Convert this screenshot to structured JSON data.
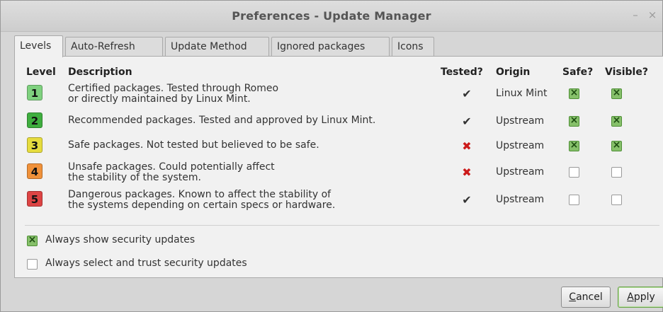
{
  "window": {
    "title": "Preferences - Update Manager",
    "minimize_glyph": "–",
    "close_glyph": "×"
  },
  "tabs": [
    {
      "label": "Levels",
      "active": true
    },
    {
      "label": "Auto-Refresh",
      "active": false
    },
    {
      "label": "Update Method",
      "active": false
    },
    {
      "label": "Ignored packages",
      "active": false
    },
    {
      "label": "Icons",
      "active": false
    }
  ],
  "table": {
    "headers": {
      "level": "Level",
      "description": "Description",
      "tested": "Tested?",
      "origin": "Origin",
      "safe": "Safe?",
      "visible": "Visible?"
    },
    "rows": [
      {
        "level": "1",
        "color": "#7fd17f",
        "line1": "Certified packages. Tested through Romeo",
        "line2": "or directly maintained by Linux Mint.",
        "tested": "✔",
        "tested_state": "yes",
        "origin": "Linux Mint",
        "safe": true,
        "visible": true
      },
      {
        "level": "2",
        "color": "#3fae3f",
        "line1": "Recommended packages. Tested and approved by Linux Mint.",
        "line2": "",
        "tested": "✔",
        "tested_state": "yes",
        "origin": "Upstream",
        "safe": true,
        "visible": true
      },
      {
        "level": "3",
        "color": "#e6dc3e",
        "line1": "Safe packages. Not tested but believed to be safe.",
        "line2": "",
        "tested": "✖",
        "tested_state": "no",
        "origin": "Upstream",
        "safe": true,
        "visible": true
      },
      {
        "level": "4",
        "color": "#f0913a",
        "line1": "Unsafe packages. Could potentially affect",
        "line2": "the stability of the system.",
        "tested": "✖",
        "tested_state": "no",
        "origin": "Upstream",
        "safe": false,
        "visible": false
      },
      {
        "level": "5",
        "color": "#dd4444",
        "line1": "Dangerous packages. Known to affect the stability of",
        "line2": "the systems depending on certain specs or hardware.",
        "tested": "✔",
        "tested_state": "yes",
        "origin": "Upstream",
        "safe": false,
        "visible": false
      }
    ]
  },
  "options": {
    "always_show_security": {
      "label": "Always show security updates",
      "checked": true
    },
    "always_select_security": {
      "label": "Always select and trust security updates",
      "checked": false
    }
  },
  "buttons": {
    "cancel": {
      "label_mnemonic": "C",
      "label_rest": "ancel"
    },
    "apply": {
      "label_mnemonic": "A",
      "label_rest": "pply"
    }
  },
  "colors": {
    "tested_yes": "#333333",
    "tested_no": "#cc1a1a",
    "check_on": "#86c06a"
  }
}
